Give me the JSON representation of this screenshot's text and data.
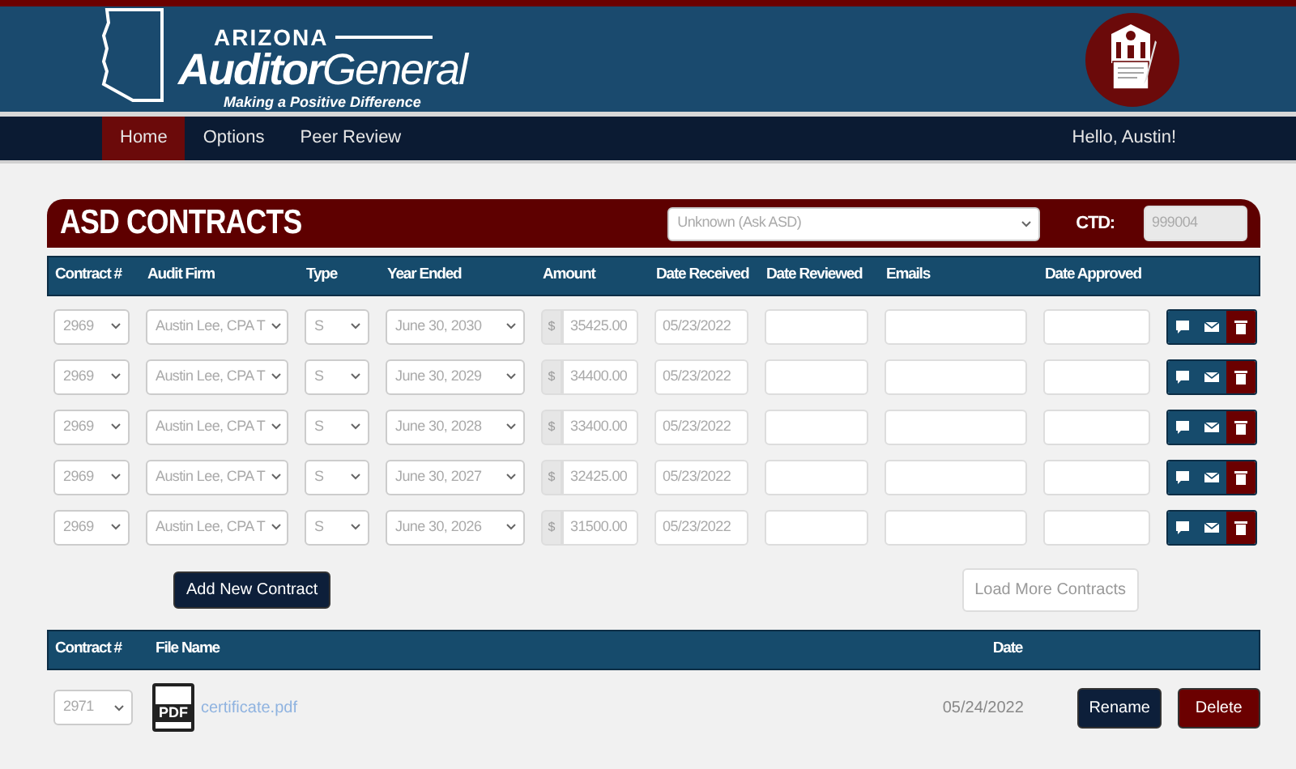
{
  "header": {
    "logo_top": "ARIZONA",
    "logo_bold": "Auditor",
    "logo_light": "General",
    "tagline": "Making a Positive Difference"
  },
  "nav": {
    "items": [
      {
        "label": "Home",
        "selected": true
      },
      {
        "label": "Options",
        "selected": false
      },
      {
        "label": "Peer Review",
        "selected": false
      }
    ],
    "greeting": "Hello, Austin!"
  },
  "contracts": {
    "title": "ASD CONTRACTS",
    "type_select": "Unknown (Ask ASD)",
    "ctd_label": "CTD:",
    "ctd_value": "999004",
    "columns": [
      "Contract #",
      "Audit Firm",
      "Type",
      "Year Ended",
      "Amount",
      "Date Received",
      "Date Reviewed",
      "Emails",
      "Date Approved"
    ],
    "rows": [
      {
        "contract": "2969",
        "firm": "Austin Lee, CPA T",
        "type": "S",
        "year": "June 30, 2030",
        "currency": "$",
        "amount": "35425.00",
        "received": "05/23/2022"
      },
      {
        "contract": "2969",
        "firm": "Austin Lee, CPA T",
        "type": "S",
        "year": "June 30, 2029",
        "currency": "$",
        "amount": "34400.00",
        "received": "05/23/2022"
      },
      {
        "contract": "2969",
        "firm": "Austin Lee, CPA T",
        "type": "S",
        "year": "June 30, 2028",
        "currency": "$",
        "amount": "33400.00",
        "received": "05/23/2022"
      },
      {
        "contract": "2969",
        "firm": "Austin Lee, CPA T",
        "type": "S",
        "year": "June 30, 2027",
        "currency": "$",
        "amount": "32425.00",
        "received": "05/23/2022"
      },
      {
        "contract": "2969",
        "firm": "Austin Lee, CPA T",
        "type": "S",
        "year": "June 30, 2026",
        "currency": "$",
        "amount": "31500.00",
        "received": "05/23/2022"
      }
    ],
    "add_button": "Add New Contract",
    "load_more": "Load More Contracts"
  },
  "files": {
    "columns": [
      "Contract #",
      "File Name",
      "Date"
    ],
    "rows": [
      {
        "contract": "2971",
        "icon_text": "PDF",
        "file": "certificate.pdf",
        "date": "05/24/2022",
        "rename": "Rename",
        "delete": "Delete"
      }
    ]
  }
}
